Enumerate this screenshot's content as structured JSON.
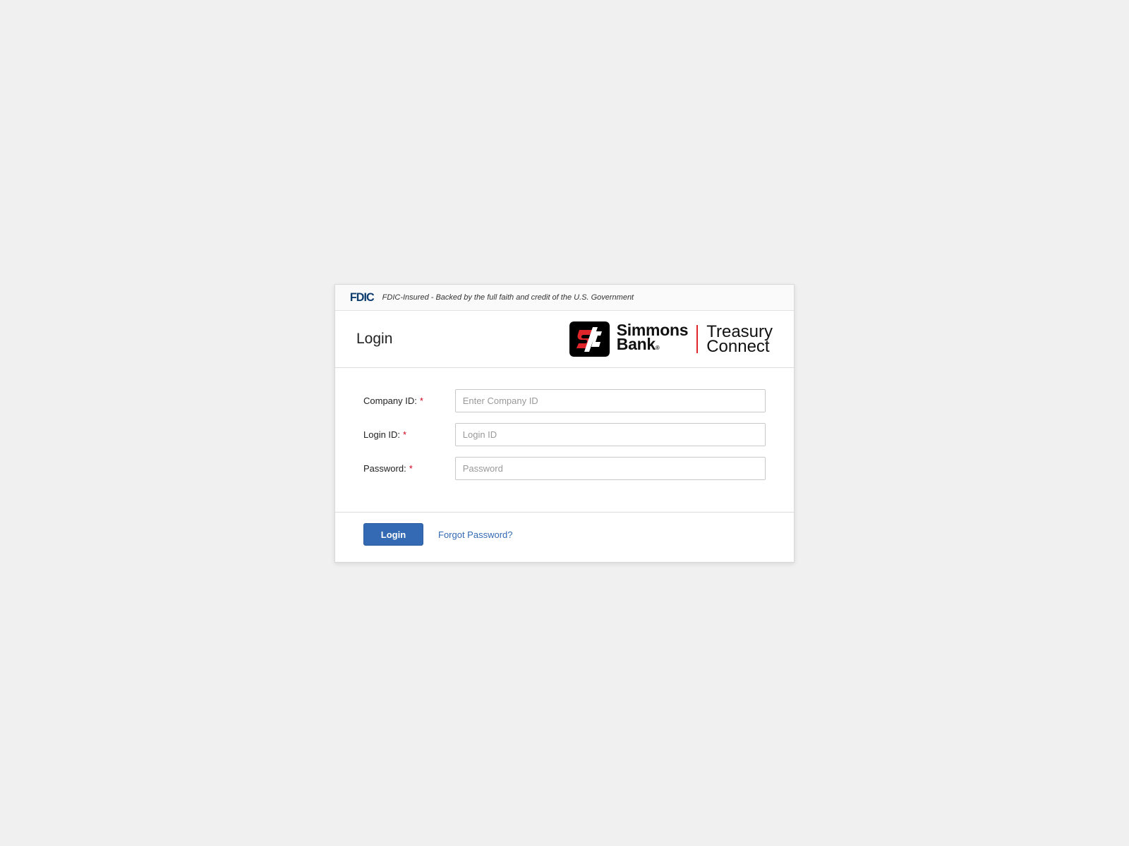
{
  "fdic": {
    "logo": "FDIC",
    "text": "FDIC-Insured - Backed by the full faith and credit of the U.S. Government"
  },
  "header": {
    "title": "Login",
    "brand_line1": "Simmons",
    "brand_line2": "Bank",
    "brand_reg": "®",
    "product_line1": "Treasury",
    "product_line2": "Connect"
  },
  "form": {
    "required_mark": "*",
    "company_id": {
      "label": "Company ID:",
      "placeholder": "Enter Company ID",
      "value": ""
    },
    "login_id": {
      "label": "Login ID:",
      "placeholder": "Login ID",
      "value": ""
    },
    "password": {
      "label": "Password:",
      "placeholder": "Password",
      "value": ""
    }
  },
  "footer": {
    "login_label": "Login",
    "forgot_label": "Forgot Password?"
  },
  "colors": {
    "background": "#f0f0f0",
    "primary": "#336ab3",
    "brand_red": "#e0252b",
    "fdic_blue": "#0d3c6e",
    "required": "#d0021b"
  }
}
